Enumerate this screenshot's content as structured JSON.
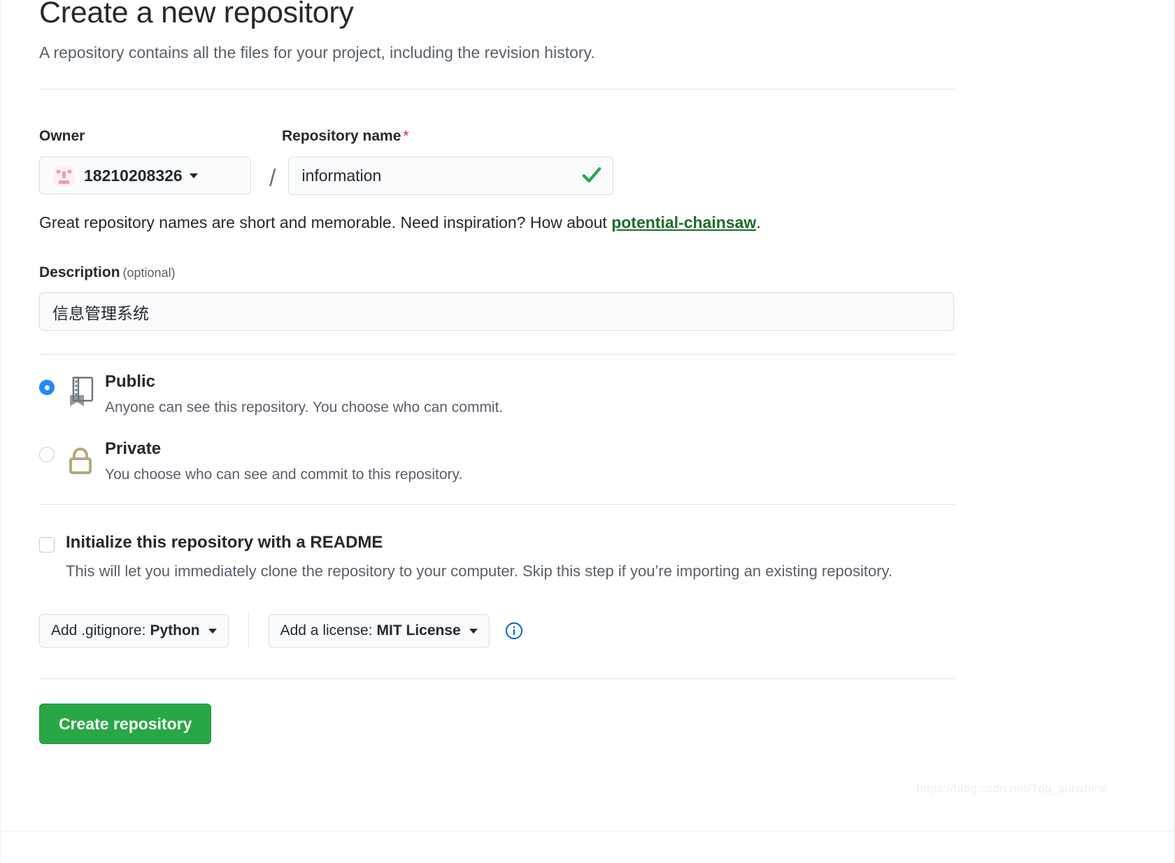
{
  "header": {
    "title": "Create a new repository",
    "subtitle": "A repository contains all the files for your project, including the revision history."
  },
  "owner": {
    "label": "Owner",
    "name": "18210208326",
    "avatar_icon": "identicon-avatar",
    "caret_icon": "chevron-down-icon"
  },
  "repo_name": {
    "label": "Repository name",
    "required_marker": "*",
    "value": "information",
    "placeholder": "",
    "valid_icon": "checkmark-icon",
    "separator": "/"
  },
  "hint": {
    "prefix": "Great repository names are short and memorable. Need inspiration? How about ",
    "suggestion": "potential-chainsaw",
    "suffix": "."
  },
  "description": {
    "label": "Description",
    "optional": "(optional)",
    "value": "信息管理系统",
    "placeholder": ""
  },
  "visibility": {
    "options": [
      {
        "id": "public",
        "name": "Public",
        "description": "Anyone can see this repository. You choose who can commit.",
        "selected": true,
        "icon": "repo-book-icon"
      },
      {
        "id": "private",
        "name": "Private",
        "description": "You choose who can see and commit to this repository.",
        "selected": false,
        "icon": "lock-icon"
      }
    ]
  },
  "readme": {
    "checked": false,
    "title": "Initialize this repository with a README",
    "description": "This will let you immediately clone the repository to your computer. Skip this step if you’re importing an existing repository."
  },
  "options": {
    "gitignore": {
      "prefix": "Add .gitignore:",
      "value": "Python",
      "caret_icon": "chevron-down-icon"
    },
    "license": {
      "prefix": "Add a license:",
      "value": "MIT License",
      "caret_icon": "chevron-down-icon"
    },
    "info_icon": "info-circle-icon"
  },
  "submit": {
    "label": "Create repository"
  },
  "watermark": {
    "text": "https://blog.csdn.net/Tqq_sunshine"
  },
  "colors": {
    "accent_green": "#28a745",
    "link_green": "#1d6b2b",
    "radio_blue": "#2188ff",
    "required_red": "#cb2431",
    "lock_tan": "#b5a97f",
    "avatar_pink": "#ec9cb4"
  }
}
